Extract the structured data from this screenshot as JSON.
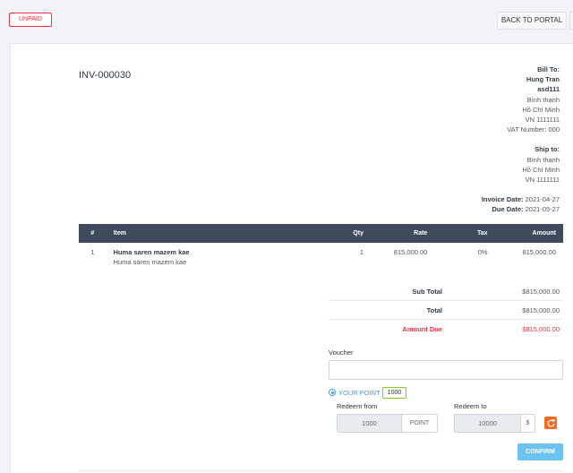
{
  "header": {
    "status": "UNPAID",
    "back_label": "BACK TO PORTAL"
  },
  "invoice": {
    "number": "INV-000030",
    "bill_to_label": "Bill To:",
    "bill_to": {
      "name": "Hung Tran",
      "company": "asd111",
      "line1": "Bình thạnh",
      "line2": "Hồ Chí Minh",
      "line3": "VN 1111111",
      "vat": "VAT Number: 000"
    },
    "ship_to_label": "Ship to:",
    "ship_to": {
      "line1": "Bình thạnh",
      "line2": "Hồ Chí Minh",
      "line3": "VN 1111111"
    },
    "invoice_date_label": "Invoice Date:",
    "invoice_date": "2021-04-27",
    "due_date_label": "Due Date:",
    "due_date": "2021-05-27"
  },
  "table": {
    "headers": {
      "num": "#",
      "item": "Item",
      "qty": "Qty",
      "rate": "Rate",
      "tax": "Tax",
      "amount": "Amount"
    },
    "rows": [
      {
        "num": "1",
        "name": "Huma saren mazem kae",
        "description": "Huma saren mazem kae",
        "qty": "1",
        "rate": "815,000.00",
        "tax": "0%",
        "amount": "815,000.00"
      }
    ]
  },
  "totals": {
    "sub_total_label": "Sub Total",
    "sub_total": "$815,000.00",
    "total_label": "Total",
    "total": "$815,000.00",
    "amount_due_label": "Amount Due",
    "amount_due": "$815,000.00"
  },
  "redeem": {
    "voucher_label": "Voucher",
    "voucher_value": "",
    "your_point_label": "YOUR POINT",
    "your_point_value": "1000",
    "from_label": "Redeem from",
    "from_value": "1000",
    "from_unit": "POINT",
    "to_label": "Redeem to",
    "to_value": "10000",
    "to_unit": "$",
    "confirm_label": "CONFIRM"
  },
  "colors": {
    "danger": "#fc2d42",
    "table_header": "#3f4a5c",
    "accent": "#3b99e0",
    "refresh": "#f26d21",
    "confirm": "#6cc4ee"
  }
}
